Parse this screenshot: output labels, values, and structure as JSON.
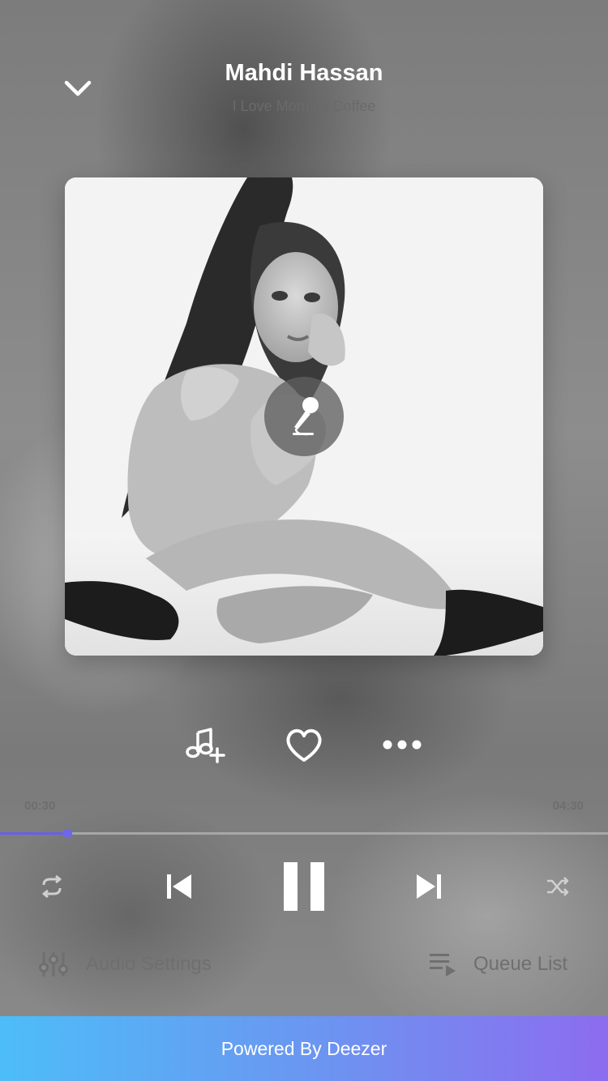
{
  "header": {
    "artist": "Mahdi Hassan",
    "song": "I Love Morning Coffee"
  },
  "player": {
    "current_time": "00:30",
    "total_time": "04:30",
    "progress_fraction": 0.11111,
    "accent_color": "#6860e8"
  },
  "actions": {
    "add_to_playlist_icon": "music-note-plus-icon",
    "like_icon": "heart-icon",
    "more_icon": "more-dots-icon",
    "lyrics_icon": "microphone-icon"
  },
  "bottom": {
    "audio_settings_label": "Audio Settings",
    "queue_list_label": "Queue List"
  },
  "footer": {
    "label": "Powered By Deezer"
  }
}
